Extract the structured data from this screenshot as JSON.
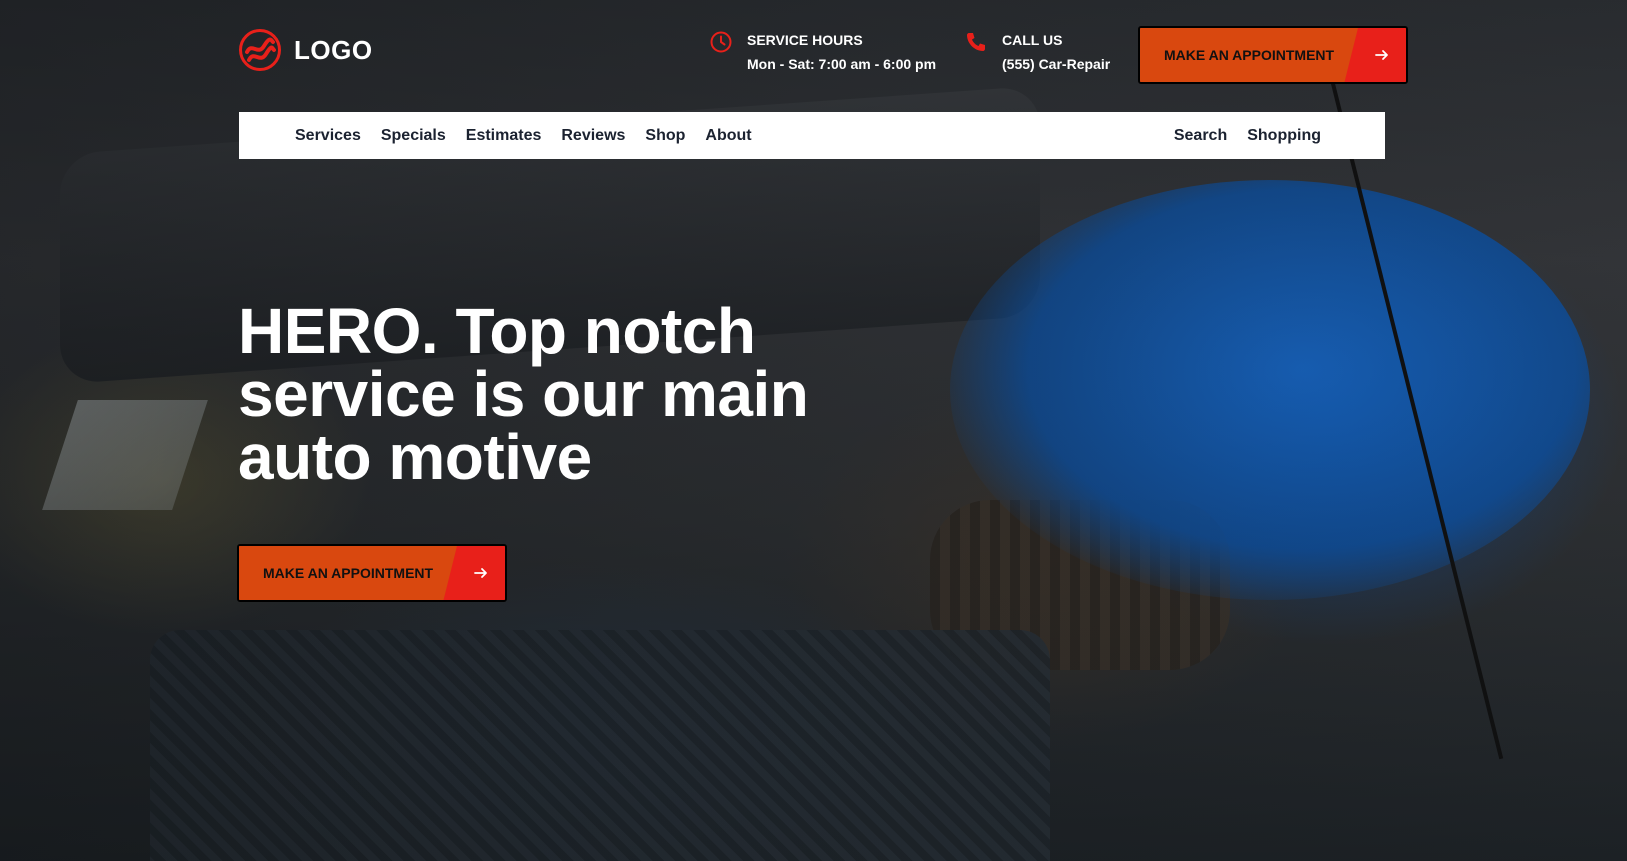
{
  "brand": {
    "logo_text": "LOGO",
    "accent_color": "#e8201a",
    "button_color": "#d9480f"
  },
  "header": {
    "service_hours": {
      "icon": "clock-icon",
      "title": "SERVICE HOURS",
      "value": "Mon - Sat: 7:00 am - 6:00 pm"
    },
    "call_us": {
      "icon": "phone-icon",
      "title": "CALL US",
      "value": "(555) Car-Repair"
    },
    "cta": {
      "label": "MAKE AN APPOINTMENT",
      "icon": "arrow-right-icon"
    }
  },
  "nav": {
    "left_items": [
      "Services",
      "Specials",
      "Estimates",
      "Reviews",
      "Shop",
      "About"
    ],
    "right_items": [
      "Search",
      "Shopping"
    ]
  },
  "hero": {
    "headline_lines": [
      "HERO. Top notch",
      "service is our main",
      "auto motive"
    ],
    "cta": {
      "label": "MAKE AN APPOINTMENT",
      "icon": "arrow-right-icon"
    }
  }
}
